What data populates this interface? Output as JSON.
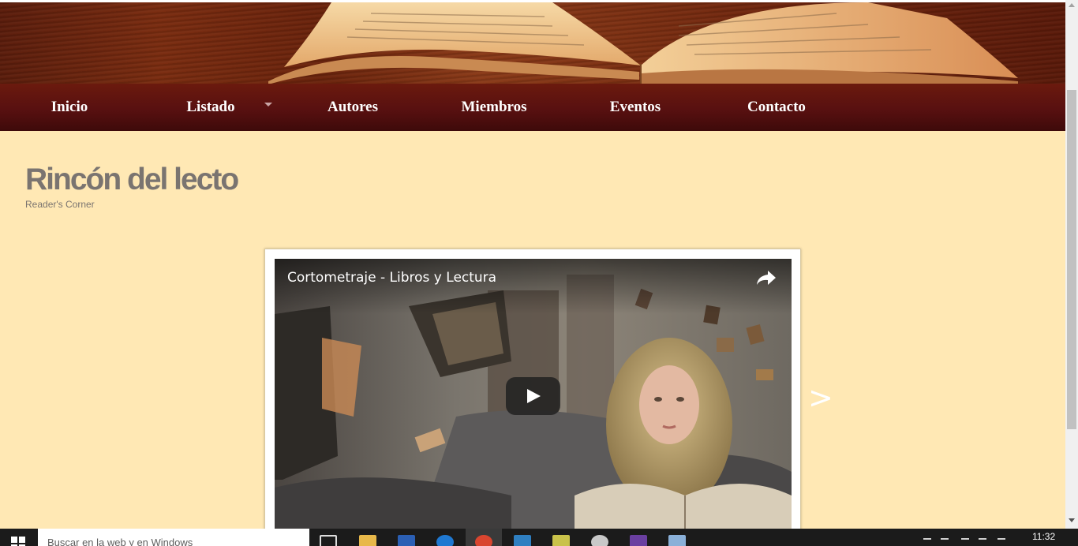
{
  "nav": {
    "items": [
      {
        "label": "Inicio"
      },
      {
        "label": "Listado",
        "has_dropdown": true
      },
      {
        "label": "Autores"
      },
      {
        "label": "Miembros"
      },
      {
        "label": "Eventos"
      },
      {
        "label": "Contacto"
      }
    ]
  },
  "site": {
    "title": "Rincón del lecto",
    "subtitle": "Reader's Corner"
  },
  "video": {
    "title": "Cortometraje - Libros y Lectura",
    "share_icon": "share-icon",
    "play_icon": "play-icon"
  },
  "carousel": {
    "next_label": ">"
  },
  "taskbar": {
    "search_placeholder": "Buscar en la web y en Windows",
    "clock": "11:32",
    "icons": [
      "task-view-icon",
      "file-explorer-icon",
      "word-icon",
      "edge-icon",
      "chrome-icon",
      "app-icon",
      "folder-icon",
      "app-icon",
      "app-icon",
      "app-icon"
    ]
  },
  "colors": {
    "page_bg": "#ffe8b4",
    "nav_bg": "#581010",
    "title_color": "#7a7470"
  }
}
